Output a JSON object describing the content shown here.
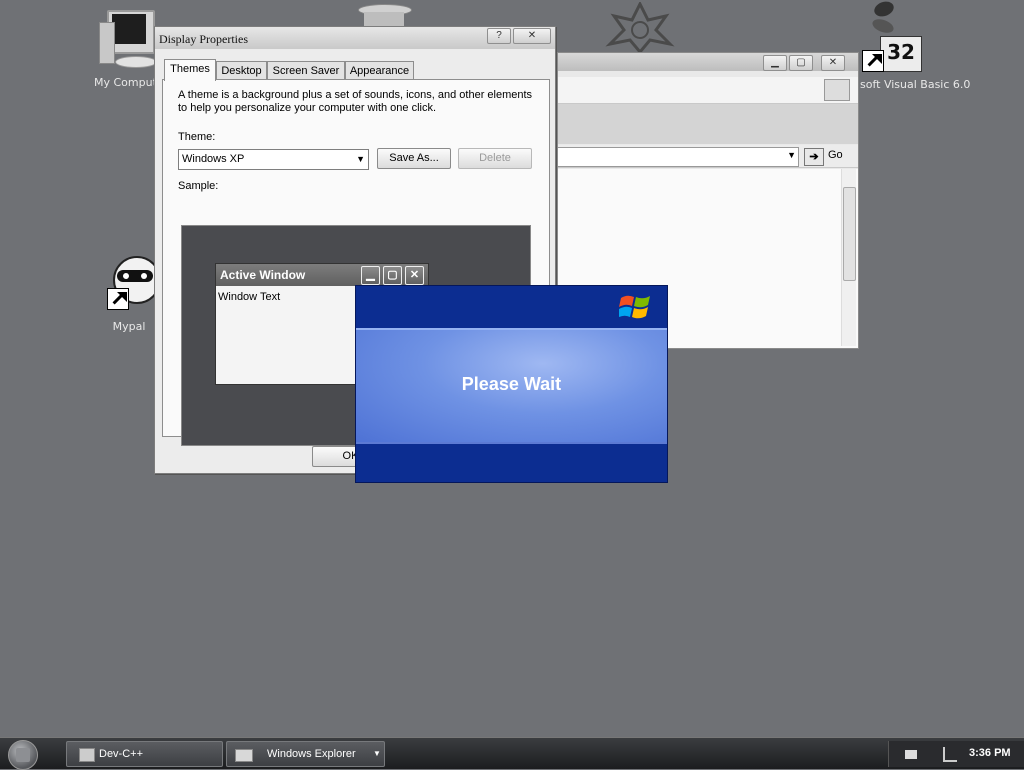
{
  "desktop": {
    "icons": [
      {
        "label": "My Comput",
        "icon": "computer-icon"
      },
      {
        "label": "Mypal",
        "icon": "raccoon-icon"
      },
      {
        "label": "soft Visual Basic 6.0",
        "icon": "vb6-icon"
      }
    ]
  },
  "explorer": {
    "go_label": "Go"
  },
  "display_properties": {
    "title": "Display Properties",
    "help_label": "?",
    "close_label": "✕",
    "tabs": [
      "Themes",
      "Desktop",
      "Screen Saver",
      "Appearance"
    ],
    "description": "A theme is a background plus a set of sounds, icons, and other elements to help you personalize your computer with one click.",
    "theme_label": "Theme:",
    "theme_value": "Windows XP",
    "save_as_label": "Save As...",
    "delete_label": "Delete",
    "sample_label": "Sample:",
    "sample_window_title": "Active Window",
    "sample_window_text": "Window Text",
    "ok_label": "OK"
  },
  "please_wait": {
    "message": "Please Wait"
  },
  "taskbar": {
    "items": [
      "Dev-C++",
      "Windows Explorer"
    ],
    "clock": "3:36 PM"
  },
  "colors": {
    "desktop": "#6f7175",
    "wait_blue": "#0c2d91"
  }
}
